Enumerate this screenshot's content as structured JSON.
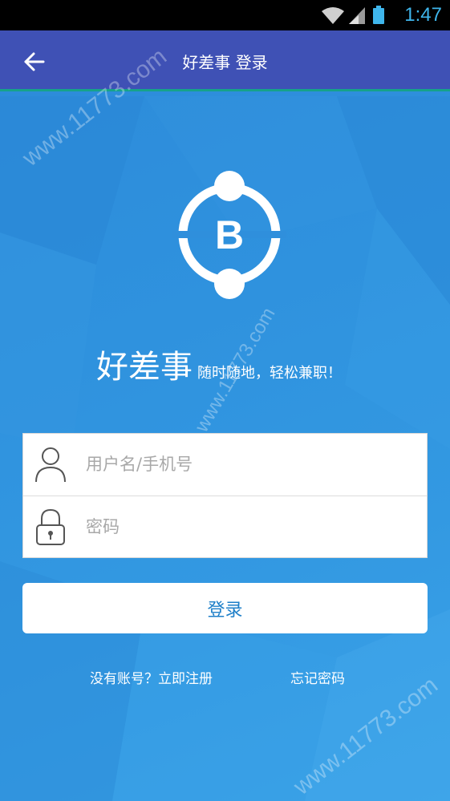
{
  "status_bar": {
    "time": "1:47",
    "icons": [
      "wifi-icon",
      "signal-icon",
      "battery-icon"
    ]
  },
  "app_bar": {
    "title": "好差事 登录",
    "back_icon": "arrow-left-icon"
  },
  "brand": {
    "logo_letter": "B",
    "name": "好差事",
    "slogan": "随时随地，轻松兼职！"
  },
  "form": {
    "username": {
      "placeholder": "用户名/手机号",
      "value": "",
      "icon": "user-icon"
    },
    "password": {
      "placeholder": "密码",
      "value": "",
      "icon": "lock-icon"
    }
  },
  "login_button_label": "登录",
  "links": {
    "register": "没有账号？立即注册",
    "forgot": "忘记密码"
  },
  "watermark": "www.11773.com",
  "colors": {
    "app_bar": "#3f51b5",
    "app_bar_border": "#16a28a",
    "background": "#2f8fdc",
    "button_text": "#1e7fc8",
    "status_text": "#3fb6ec"
  }
}
